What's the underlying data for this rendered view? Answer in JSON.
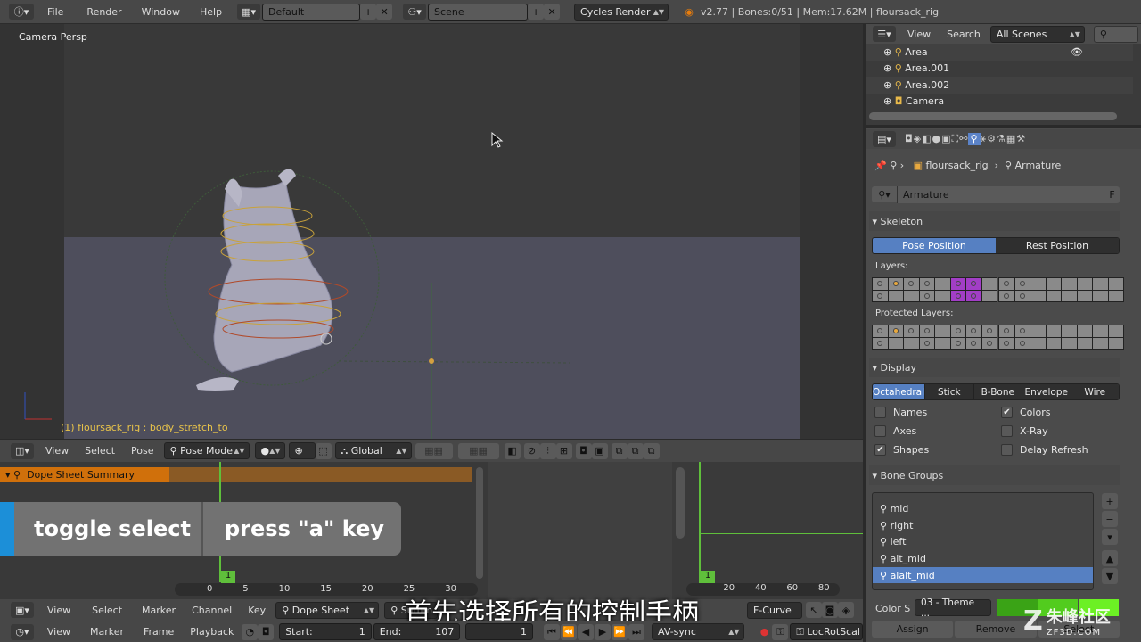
{
  "topbar": {
    "menus": [
      "File",
      "Render",
      "Window",
      "Help"
    ],
    "layout": "Default",
    "scene": "Scene",
    "engine": "Cycles Render",
    "stats": "v2.77 | Bones:0/51 | Mem:17.62M | floursack_rig"
  },
  "viewport": {
    "label": "Camera Persp",
    "status": "(1) floursack_rig : body_stretch_to"
  },
  "view_header": {
    "menus": [
      "View",
      "Select",
      "Pose"
    ],
    "mode": "Pose Mode",
    "orientation": "Global"
  },
  "dopesheet": {
    "summary": "Dope Sheet Summary",
    "frame_marker": "1",
    "ruler": [
      "0",
      "5",
      "10",
      "15",
      "20",
      "25",
      "30"
    ]
  },
  "overlay": {
    "action": "toggle select",
    "key": "press \"a\" key"
  },
  "subtitle": "首先选择所有的控制手柄",
  "graph": {
    "frame_marker": "1",
    "ruler": [
      "20",
      "40",
      "60",
      "80"
    ]
  },
  "dope_header": {
    "menus": [
      "View",
      "Select",
      "Marker",
      "Channel",
      "Key"
    ],
    "mode": "Dope Sheet",
    "summary": "Summ",
    "fcurve": "F-Curve"
  },
  "timeline": {
    "menus": [
      "View",
      "Marker",
      "Frame",
      "Playback"
    ],
    "start_label": "Start:",
    "start": "1",
    "end_label": "End:",
    "end": "107",
    "current": "1",
    "sync": "AV-sync",
    "keying": "LocRotScal"
  },
  "outliner": {
    "menus": [
      "View",
      "Search"
    ],
    "filter": "All Scenes",
    "items": [
      "Area",
      "Area.001",
      "Area.002",
      "Camera"
    ]
  },
  "properties": {
    "breadcrumb": [
      "floursack_rig",
      "Armature"
    ],
    "datablock": "Armature",
    "fake_user": "F",
    "skeleton": {
      "title": "Skeleton",
      "pose": "Pose Position",
      "rest": "Rest Position",
      "layers": "Layers:",
      "protected": "Protected Layers:"
    },
    "display": {
      "title": "Display",
      "modes": [
        "Octahedral",
        "Stick",
        "B-Bone",
        "Envelope",
        "Wire"
      ],
      "names": "Names",
      "axes": "Axes",
      "shapes": "Shapes",
      "colors": "Colors",
      "xray": "X-Ray",
      "delay": "Delay Refresh"
    },
    "bone_groups": {
      "title": "Bone Groups",
      "items": [
        "mid",
        "right",
        "left",
        "alt_mid",
        "alalt_mid"
      ],
      "color_set_label": "Color S",
      "color_set": "03 - Theme ...",
      "assign": "Assign",
      "remove": "Remove",
      "select": "Select"
    }
  },
  "watermark": {
    "brand": "朱峰社区",
    "site": "ZF3D.COM"
  }
}
